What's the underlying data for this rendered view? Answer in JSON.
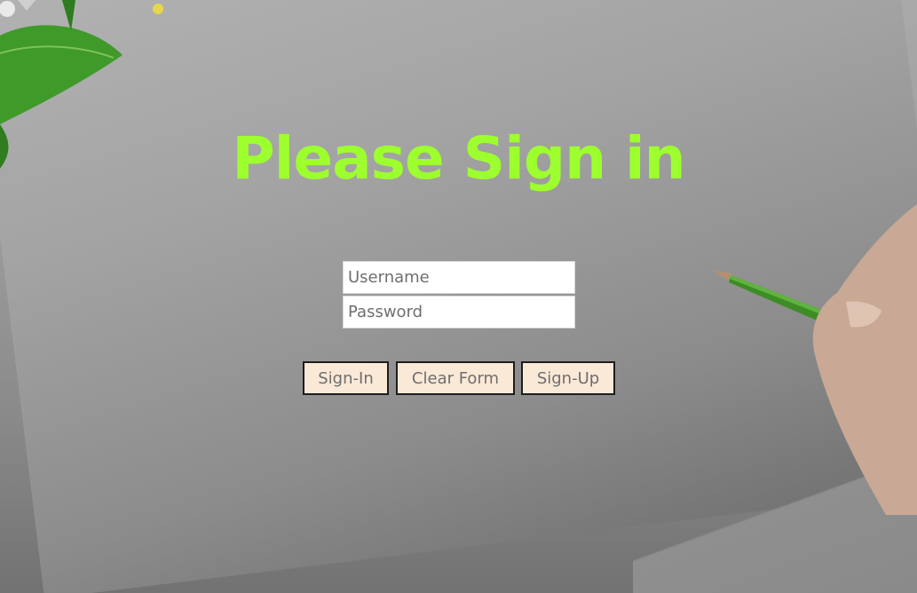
{
  "page": {
    "title": "Please Sign in"
  },
  "form": {
    "username_placeholder": "Username",
    "password_placeholder": "Password",
    "username_value": "",
    "password_value": ""
  },
  "buttons": {
    "sign_in": "Sign-In",
    "clear_form": "Clear Form",
    "sign_up": "Sign-Up"
  },
  "colors": {
    "title": "#9dff2e",
    "button_bg": "#fbe9d8",
    "button_border": "#1d1d1d",
    "background": "#9e9e9e"
  },
  "icons": {
    "decor_top_left": "leaves-decoration",
    "decor_right": "hand-with-pencil"
  }
}
